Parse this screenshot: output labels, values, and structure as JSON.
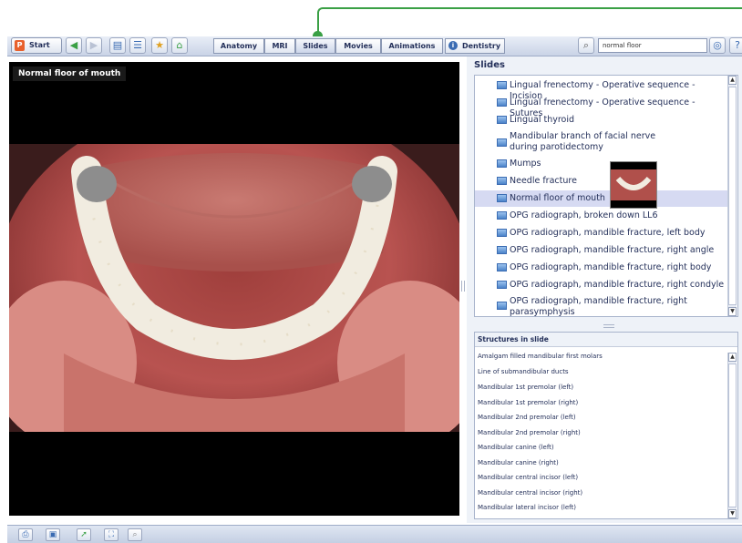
{
  "toolbar": {
    "start_label": "Start",
    "tabs": [
      {
        "label": "Anatomy",
        "active": false
      },
      {
        "label": "MRI",
        "active": false
      },
      {
        "label": "Slides",
        "active": true
      },
      {
        "label": "Movies",
        "active": false
      },
      {
        "label": "Animations",
        "active": false
      },
      {
        "label": "Dentistry",
        "active": false
      }
    ],
    "search_value": "normal floor",
    "icons": [
      "back-arrow-icon",
      "forward-arrow-icon",
      "document-icon",
      "list-icon",
      "favorite-star-icon",
      "home-icon",
      "search-icon",
      "globe-icon",
      "help-icon"
    ]
  },
  "viewer": {
    "title": "Normal floor of mouth"
  },
  "slides_panel": {
    "title": "Slides",
    "items": [
      {
        "label": "Lingual frenectomy - Operative sequence - Incision",
        "selected": false
      },
      {
        "label": "Lingual frenectomy - Operative sequence - Sutures",
        "selected": false
      },
      {
        "label": "Lingual thyroid",
        "selected": false
      },
      {
        "label": "Mandibular branch of facial nerve during parotidectomy",
        "selected": false
      },
      {
        "label": "Mumps",
        "selected": false
      },
      {
        "label": "Needle fracture",
        "selected": false
      },
      {
        "label": "Normal floor of mouth",
        "selected": true
      },
      {
        "label": "OPG radiograph, broken down LL6",
        "selected": false
      },
      {
        "label": "OPG radiograph, mandible fracture, left body",
        "selected": false
      },
      {
        "label": "OPG radiograph, mandible fracture, right angle",
        "selected": false
      },
      {
        "label": "OPG radiograph, mandible fracture, right body",
        "selected": false
      },
      {
        "label": "OPG radiograph, mandible fracture, right condyle",
        "selected": false
      },
      {
        "label": "OPG radiograph, mandible fracture, right parasymphysis",
        "selected": false
      }
    ]
  },
  "structures_panel": {
    "title": "Structures in slide",
    "items": [
      "Amalgam filled mandibular first molars",
      "Line of submandibular ducts",
      "Mandibular 1st premolar (left)",
      "Mandibular 1st premolar (right)",
      "Mandibular 2nd premolar (left)",
      "Mandibular 2nd premolar (right)",
      "Mandibular canine (left)",
      "Mandibular canine (right)",
      "Mandibular central incisor (left)",
      "Mandibular central incisor (right)",
      "Mandibular lateral incisor (left)"
    ]
  },
  "bottom_bar": {
    "icons": [
      "print-icon",
      "save-icon",
      "export-icon",
      "fullscreen-icon",
      "zoom-icon"
    ]
  },
  "colors": {
    "accent": "#3aa045",
    "selection": "#d6daf2",
    "text": "#24305a",
    "viewer_bg": "#000000"
  }
}
